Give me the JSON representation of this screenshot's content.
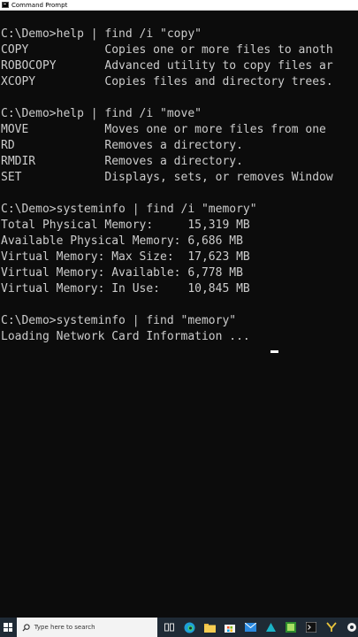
{
  "window": {
    "title": "Command Prompt"
  },
  "console": {
    "lines": [
      "C:\\Demo>help | find /i \"copy\"",
      "COPY           Copies one or more files to anoth",
      "ROBOCOPY       Advanced utility to copy files ar",
      "XCOPY          Copies files and directory trees.",
      "",
      "C:\\Demo>help | find /i \"move\"",
      "MOVE           Moves one or more files from one",
      "RD             Removes a directory.",
      "RMDIR          Removes a directory.",
      "SET            Displays, sets, or removes Window",
      "",
      "C:\\Demo>systeminfo | find /i \"memory\"",
      "Total Physical Memory:     15,319 MB",
      "Available Physical Memory: 6,686 MB",
      "Virtual Memory: Max Size:  17,623 MB",
      "Virtual Memory: Available: 6,778 MB",
      "Virtual Memory: In Use:    10,845 MB",
      "",
      "C:\\Demo>systeminfo | find \"memory\"",
      "Loading Network Card Information ..."
    ]
  },
  "taskbar": {
    "search_placeholder": "Type here to search",
    "icons": [
      "task-view-icon",
      "edge-icon",
      "file-explorer-icon",
      "store-icon",
      "mail-icon",
      "app-icon",
      "notepad-plus-icon",
      "terminal-icon",
      "app-icon-2",
      "app-icon-3"
    ]
  },
  "colors": {
    "console_bg": "#0c0c0c",
    "console_fg": "#cccccc",
    "taskbar_bg": "#1f2a35"
  }
}
